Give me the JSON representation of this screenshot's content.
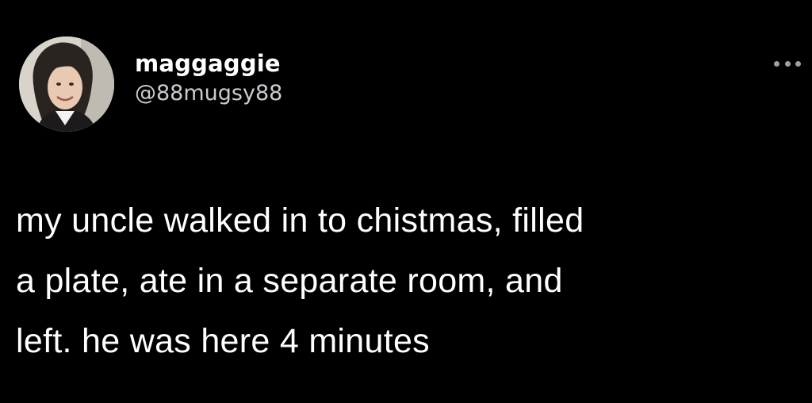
{
  "tweet": {
    "author": {
      "display_name": "maggaggie",
      "handle": "@88mugsy88",
      "avatar_icon": "profile-photo"
    },
    "more_icon": "ellipsis-icon",
    "text_lines": [
      "my uncle walked in to chistmas, filled",
      "a plate, ate in a separate room, and",
      "left. he was here 4 minutes"
    ]
  }
}
